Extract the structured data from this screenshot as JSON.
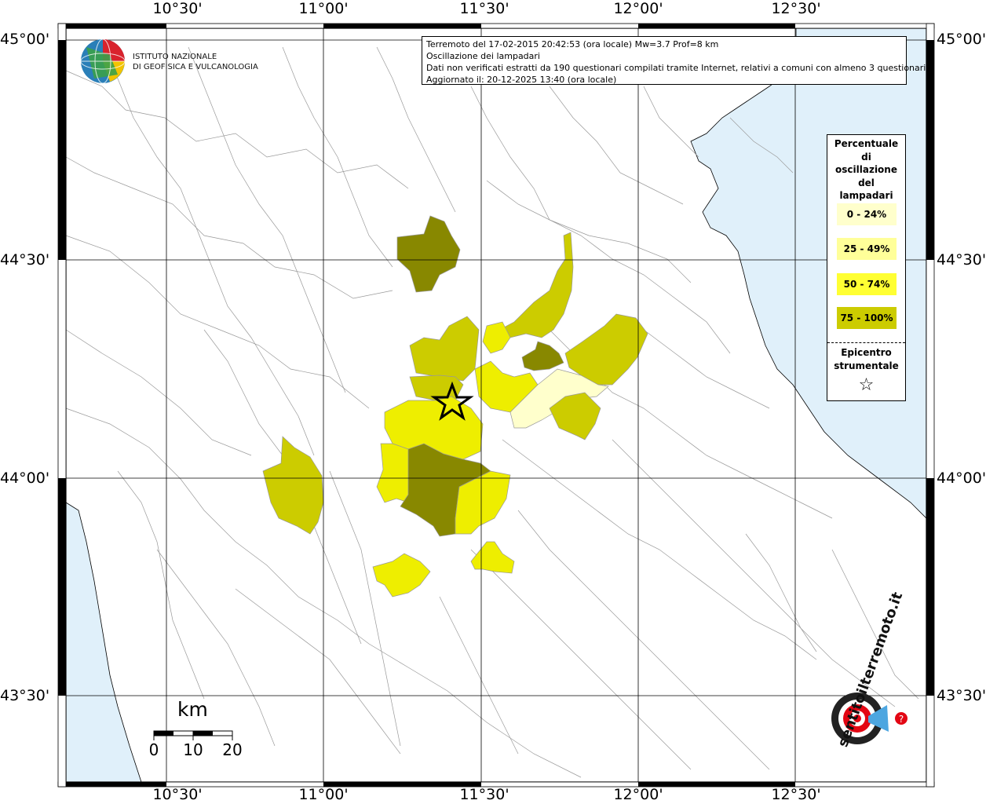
{
  "map": {
    "lon_labels": [
      "10°30'",
      "11°00'",
      "11°30'",
      "12°00'",
      "12°30'"
    ],
    "lat_labels": [
      "45°00'",
      "44°30'",
      "44°00'",
      "43°30'"
    ]
  },
  "info": {
    "line1": "Terremoto del 17-02-2015 20:42:53 (ora locale) Mw=3.7 Prof=8 km",
    "line2": "Oscillazione dei lampadari",
    "line3": "Dati non verificati estratti da 190 questionari compilati tramite Internet, relativi a comuni con almeno 3 questionari.",
    "line4": "Aggiornato il: 20-12-2025 13:40 (ora locale)"
  },
  "logo": {
    "line1": "ISTITUTO NAZIONALE",
    "line2": "DI GEOFISICA E VULCANOLOGIA"
  },
  "legend": {
    "title_lines": [
      "Percentuale",
      "di",
      "oscillazione",
      "del",
      "lampadari"
    ],
    "classes": [
      {
        "label": "0 - 24%",
        "color": "#FFFFCC"
      },
      {
        "label": "25 - 49%",
        "color": "#FFFF99"
      },
      {
        "label": "50 - 74%",
        "color": "#FFFF33"
      },
      {
        "label": "75 - 100%",
        "color": "#CCCC00"
      }
    ],
    "epicenter_line1": "Epicentro",
    "epicenter_line2": "strumentale",
    "epicenter_symbol": "☆"
  },
  "scale": {
    "unit": "km",
    "ticks": [
      "0",
      "10",
      "20"
    ]
  },
  "watermark": {
    "word1": "sentitoilterremoto",
    "word2": ".it",
    "url": "www.haisentitoilterremoto.it"
  },
  "colors": {
    "sea": "#E0F0FA",
    "fill_0_24": "#FFFFCC",
    "fill_25_49": "#FFFF99",
    "fill_50_74": "#EEEE00",
    "fill_75_100": "#CCCC00",
    "fill_dark": "#888800",
    "brand_red": "#E30613"
  }
}
